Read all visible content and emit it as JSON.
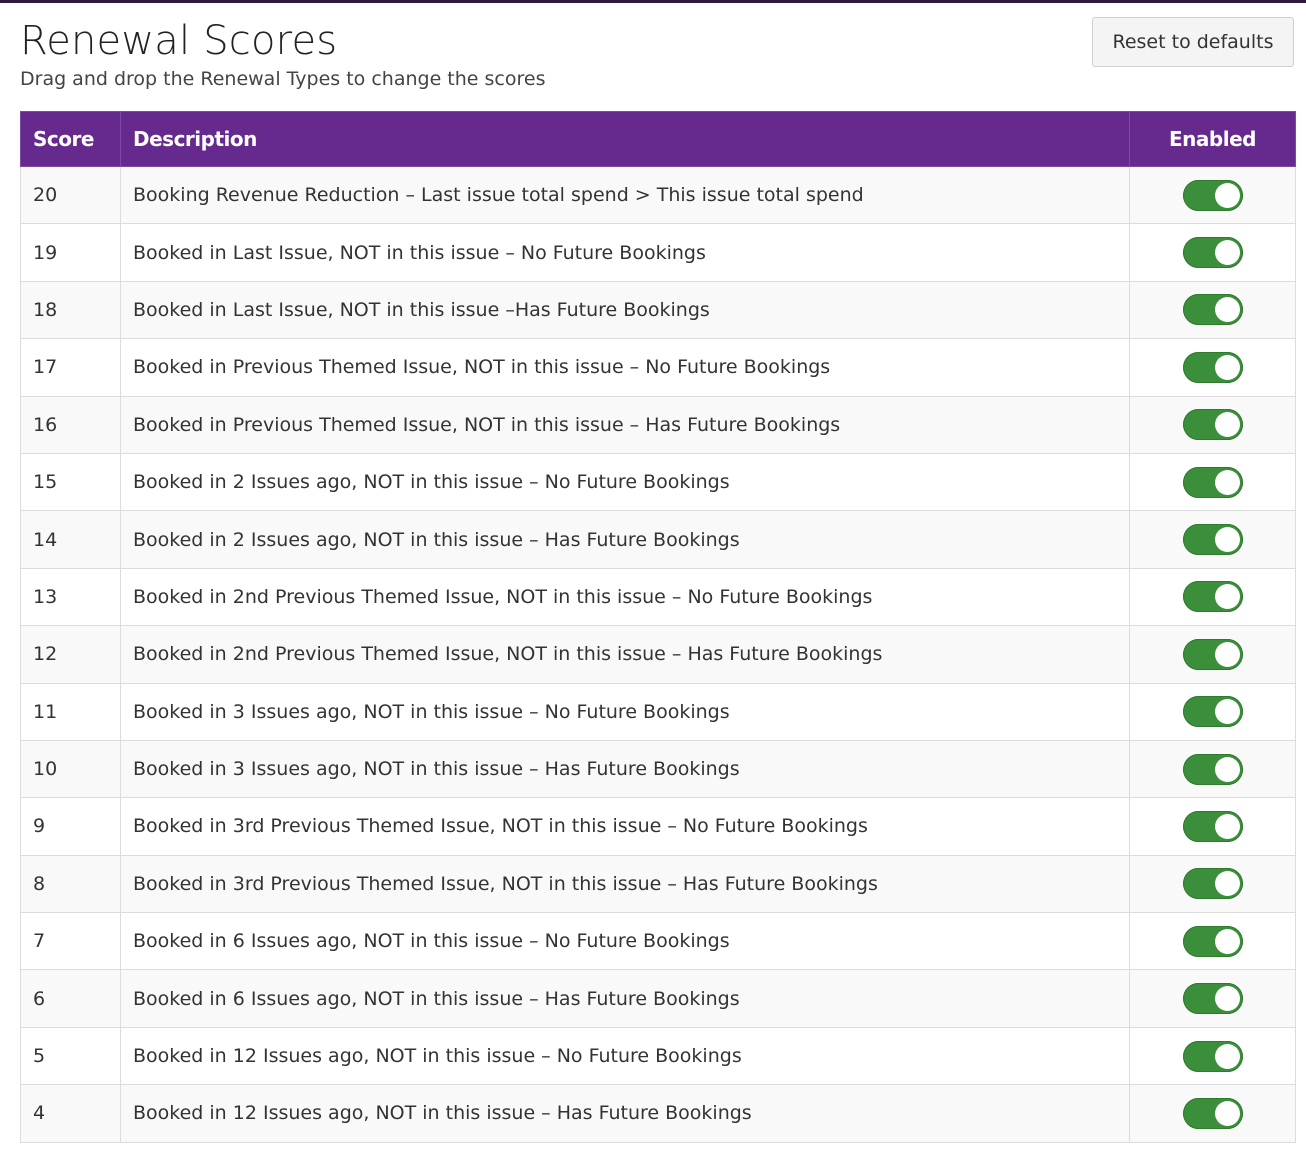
{
  "header": {
    "title": "Renewal Scores",
    "subtitle": "Drag and drop the Renewal Types to change the scores",
    "reset_label": "Reset to defaults"
  },
  "table": {
    "columns": {
      "score": "Score",
      "description": "Description",
      "enabled": "Enabled"
    },
    "rows": [
      {
        "score": "20",
        "description": "Booking Revenue Reduction – Last issue total spend > This issue total spend",
        "enabled": true
      },
      {
        "score": "19",
        "description": "Booked in Last Issue, NOT in this issue – No Future Bookings",
        "enabled": true
      },
      {
        "score": "18",
        "description": "Booked in Last Issue, NOT in this issue –Has Future Bookings",
        "enabled": true
      },
      {
        "score": "17",
        "description": "Booked in Previous Themed Issue, NOT in this issue – No Future Bookings",
        "enabled": true
      },
      {
        "score": "16",
        "description": "Booked in Previous Themed Issue, NOT in this issue – Has Future Bookings",
        "enabled": true
      },
      {
        "score": "15",
        "description": "Booked in 2 Issues ago, NOT in this issue – No Future Bookings",
        "enabled": true
      },
      {
        "score": "14",
        "description": "Booked in 2 Issues ago, NOT in this issue – Has Future Bookings",
        "enabled": true
      },
      {
        "score": "13",
        "description": "Booked in 2nd Previous Themed Issue, NOT in this issue – No Future Bookings",
        "enabled": true
      },
      {
        "score": "12",
        "description": "Booked in 2nd Previous Themed Issue, NOT in this issue – Has Future Bookings",
        "enabled": true
      },
      {
        "score": "11",
        "description": "Booked in 3 Issues ago, NOT in this issue – No Future Bookings",
        "enabled": true
      },
      {
        "score": "10",
        "description": "Booked in 3 Issues ago, NOT in this issue – Has Future Bookings",
        "enabled": true
      },
      {
        "score": "9",
        "description": "Booked in 3rd Previous Themed Issue, NOT in this issue – No Future Bookings",
        "enabled": true
      },
      {
        "score": "8",
        "description": "Booked in 3rd Previous Themed Issue, NOT in this issue – Has Future Bookings",
        "enabled": true
      },
      {
        "score": "7",
        "description": "Booked in 6 Issues ago, NOT in this issue – No Future Bookings",
        "enabled": true
      },
      {
        "score": "6",
        "description": "Booked in 6 Issues ago, NOT in this issue – Has Future Bookings",
        "enabled": true
      },
      {
        "score": "5",
        "description": "Booked in 12 Issues ago, NOT in this issue – No Future Bookings",
        "enabled": true
      },
      {
        "score": "4",
        "description": "Booked in 12 Issues ago, NOT in this issue – Has Future Bookings",
        "enabled": true
      }
    ]
  },
  "colors": {
    "header_bg": "#662a8e",
    "toggle_on": "#3b8f3b"
  }
}
